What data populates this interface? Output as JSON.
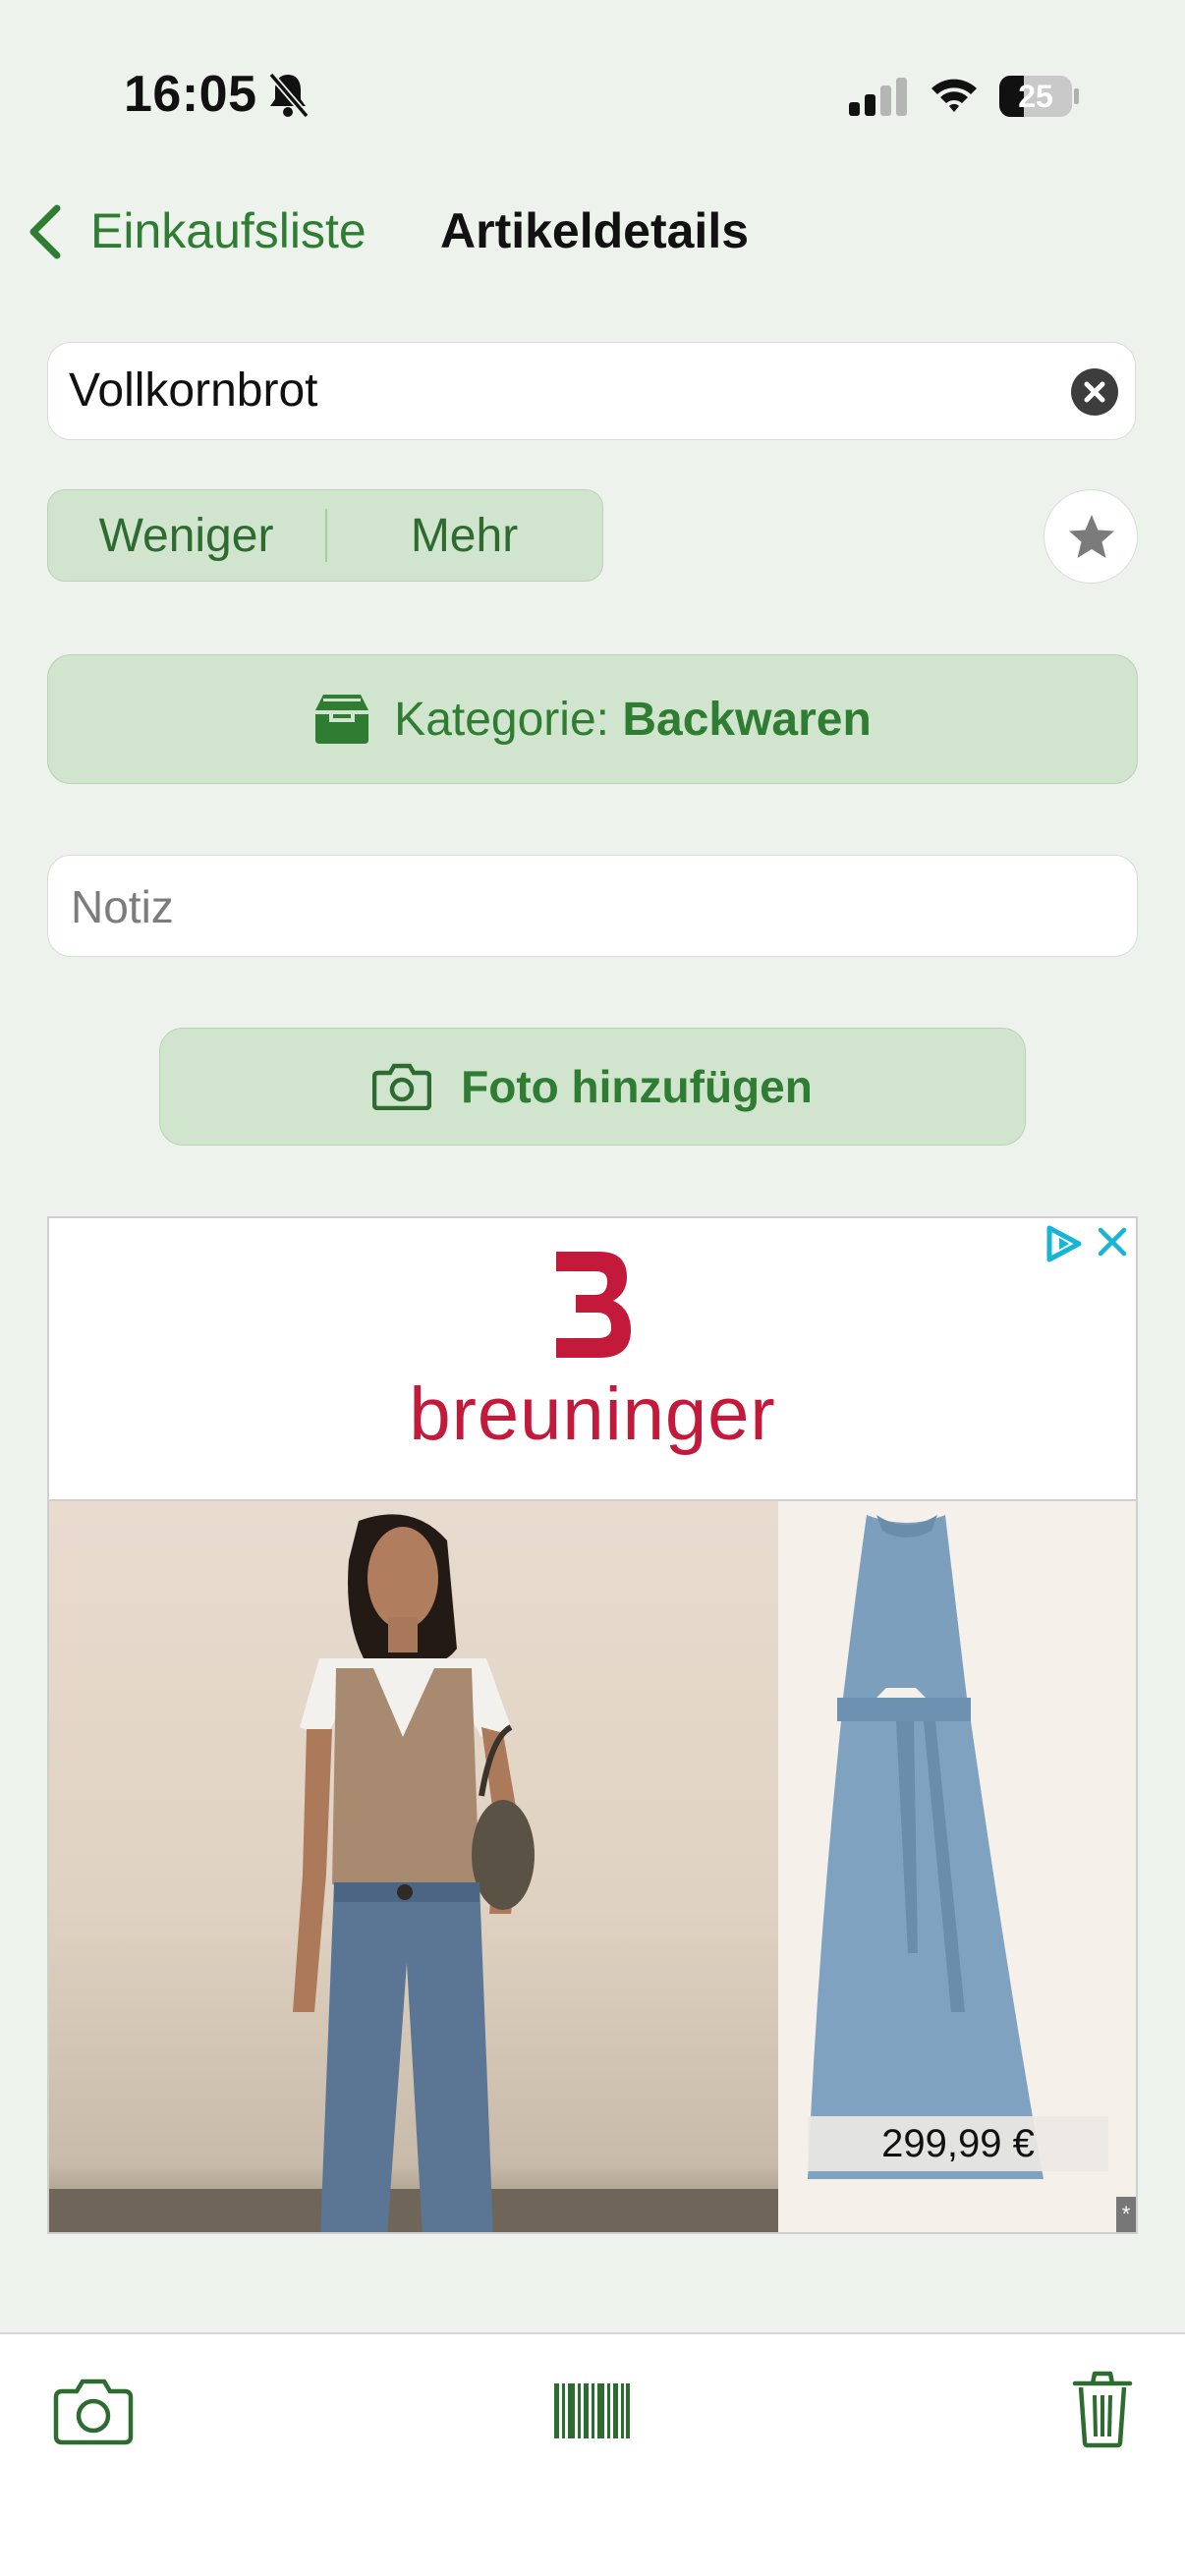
{
  "status_bar": {
    "time": "16:05",
    "battery_level": "25",
    "icons": [
      "bell-slash-icon",
      "signal-icon",
      "wifi-icon",
      "battery-icon"
    ]
  },
  "nav": {
    "back_label": "Einkaufsliste",
    "title": "Artikeldetails"
  },
  "item": {
    "name": "Vollkornbrot",
    "clear_icon": "clear-icon"
  },
  "stepper": {
    "less_label": "Weniger",
    "more_label": "Mehr"
  },
  "favorite_icon": "star-icon",
  "category": {
    "prefix": "Kategorie:",
    "value": "Backwaren",
    "icon": "tray-icon"
  },
  "note": {
    "placeholder": "Notiz",
    "value": ""
  },
  "photo_button": {
    "label": "Foto hinzufügen",
    "icon": "camera-icon"
  },
  "ad": {
    "brand": "breuninger",
    "price": "299,99 €",
    "marker": "*",
    "brand_color": "#C31A3C"
  },
  "bottom_bar": {
    "items": [
      "camera-icon",
      "barcode-icon",
      "trash-icon"
    ]
  },
  "colors": {
    "accent": "#2E7D32",
    "background": "#EDF3EC",
    "button_fill": "#D1E4CE"
  }
}
